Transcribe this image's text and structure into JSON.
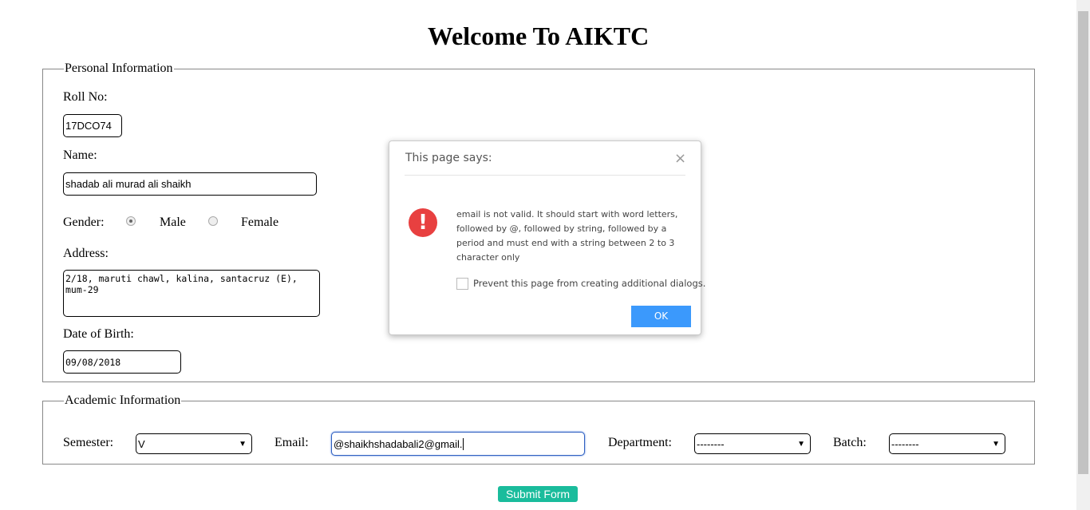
{
  "title": "Welcome To AIKTC",
  "personal": {
    "legend": "Personal Information",
    "roll_label": "Roll No:",
    "roll_value": "17DCO74",
    "name_label": "Name:",
    "name_value": "shadab ali murad ali shaikh",
    "gender_label": "Gender:",
    "male": "Male",
    "female": "Female",
    "address_label": "Address:",
    "address_value": "2/18, maruti chawl, kalina, santacruz (E),\nmum-29",
    "dob_label": "Date of Birth:",
    "dob_value": "09/08/2018"
  },
  "academic": {
    "legend": "Academic Information",
    "semester_label": "Semester:",
    "semester_value": "V",
    "email_label": "Email:",
    "email_value": "@shaikhshadabali2@gmail.",
    "department_label": "Department:",
    "department_value": "--------",
    "batch_label": "Batch:",
    "batch_value": "--------"
  },
  "submit": "Submit Form",
  "dialog": {
    "title": "This page says:",
    "message": "email is not valid. It should start with word letters, followed by @, followed by string, followed by a period and must end with a string between 2 to 3 character only",
    "checkbox": "Prevent this page from creating additional dialogs.",
    "ok": "OK",
    "accent": "#3b99fc",
    "error_color": "#e84040"
  }
}
